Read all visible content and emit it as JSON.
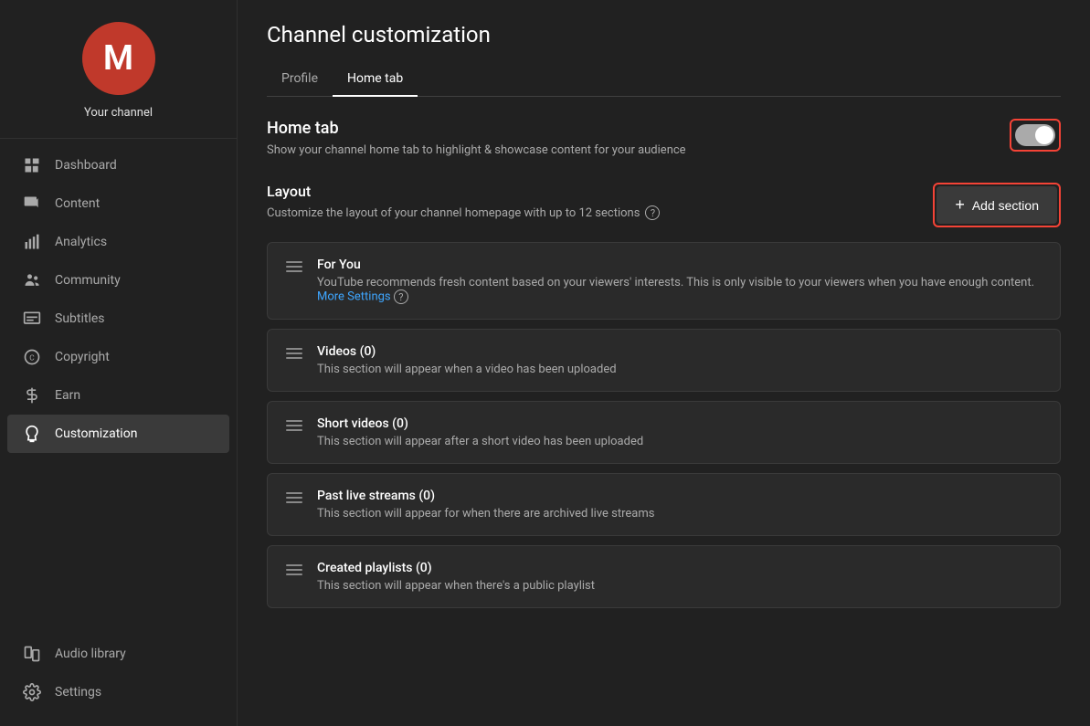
{
  "channel": {
    "initial": "M",
    "name": "Your channel"
  },
  "sidebar": {
    "items": [
      {
        "id": "dashboard",
        "label": "Dashboard",
        "icon": "dashboard"
      },
      {
        "id": "content",
        "label": "Content",
        "icon": "content"
      },
      {
        "id": "analytics",
        "label": "Analytics",
        "icon": "analytics"
      },
      {
        "id": "community",
        "label": "Community",
        "icon": "community"
      },
      {
        "id": "subtitles",
        "label": "Subtitles",
        "icon": "subtitles"
      },
      {
        "id": "copyright",
        "label": "Copyright",
        "icon": "copyright"
      },
      {
        "id": "earn",
        "label": "Earn",
        "icon": "earn"
      },
      {
        "id": "customization",
        "label": "Customization",
        "icon": "customization",
        "active": true
      }
    ],
    "bottom": [
      {
        "id": "audio-library",
        "label": "Audio library",
        "icon": "audio"
      },
      {
        "id": "settings",
        "label": "Settings",
        "icon": "settings"
      }
    ]
  },
  "page": {
    "title": "Channel customization",
    "tabs": [
      {
        "id": "profile",
        "label": "Profile",
        "active": false
      },
      {
        "id": "home-tab",
        "label": "Home tab",
        "active": true
      }
    ]
  },
  "home_tab": {
    "title": "Home tab",
    "description": "Show your channel home tab to highlight & showcase content for your audience",
    "toggle_on": true
  },
  "layout": {
    "title": "Layout",
    "description": "Customize the layout of your channel homepage with up to 12 sections",
    "add_section_label": "Add section",
    "sections": [
      {
        "id": "for-you",
        "title": "For You",
        "description": "YouTube recommends fresh content based on your viewers' interests. This is only visible to your viewers when you have enough content.",
        "more_settings": true,
        "more_settings_label": "More Settings"
      },
      {
        "id": "videos",
        "title": "Videos (0)",
        "description": "This section will appear when a video has been uploaded",
        "more_settings": false
      },
      {
        "id": "short-videos",
        "title": "Short videos (0)",
        "description": "This section will appear after a short video has been uploaded",
        "more_settings": false
      },
      {
        "id": "past-live-streams",
        "title": "Past live streams (0)",
        "description": "This section will appear for when there are archived live streams",
        "more_settings": false
      },
      {
        "id": "created-playlists",
        "title": "Created playlists (0)",
        "description": "This section will appear when there's a public playlist",
        "more_settings": false
      }
    ]
  }
}
